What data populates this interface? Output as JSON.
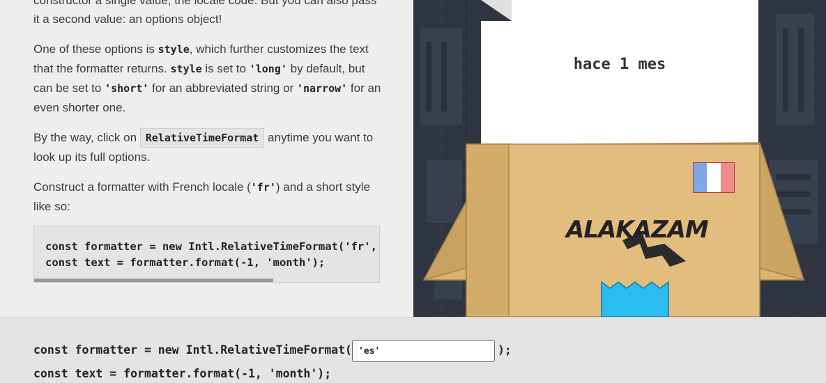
{
  "article": {
    "p1": "constructor a single value, the locale code. But you can also pass it a second value: an options object!",
    "p2": {
      "t1": "One of these options is ",
      "c1": "style",
      "t2": ", which further customizes the text that the formatter returns. ",
      "c2": "style",
      "t3": " is set to ",
      "c3": "'long'",
      "t4": " by default, but can be set to ",
      "c4": "'short'",
      "t5": " for an abbreviated string or ",
      "c5": "'narrow'",
      "t6": " for an even shorter one."
    },
    "p3": {
      "t1": "By the way, click on ",
      "link": "RelativeTimeFormat",
      "t2": " anytime you want to look up its full options."
    },
    "p4": {
      "t1": "Construct a formatter with French locale (",
      "c1": "'fr'",
      "t2": ") and a short style like so:"
    },
    "code": "const formatter = new Intl.RelativeTimeFormat('fr', { style: 'short' });\nconst text = formatter.format(-1, 'month');"
  },
  "scene": {
    "output": "hace 1 mes",
    "brand": "ALAKAZAM",
    "flag_colors": [
      "#7fa6e6",
      "#ffffff",
      "#f08a8a"
    ],
    "box_color": "#e2bd7e",
    "paper_color": "#ffffff",
    "blue_item_color": "#2bbcf2",
    "background": "#2f3540"
  },
  "editor": {
    "line1_prefix": "const formatter = new Intl.RelativeTimeFormat(",
    "locale_value": "'es'",
    "line1_suffix": ");",
    "line2": "const text = formatter.format(-1, 'month');"
  }
}
